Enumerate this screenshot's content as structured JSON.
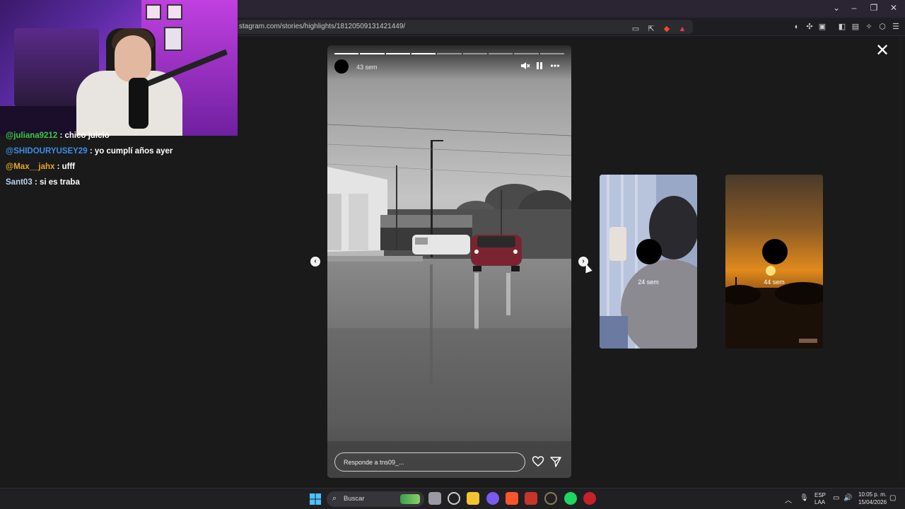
{
  "browser": {
    "url": "stagram.com/stories/highlights/18120509131421449/",
    "window_controls": [
      "⌄",
      "–",
      "❐",
      "✕"
    ]
  },
  "chat": {
    "messages": [
      {
        "user": "@juliana9212",
        "text": ": chico juicio",
        "color": "#39c84a"
      },
      {
        "user": "@SHIDOURYUSEY29",
        "text": ": yo cumplí años ayer",
        "color": "#3a8fe8"
      },
      {
        "user": "@Max__jahx",
        "text": ": ufff",
        "color": "#e8a826"
      },
      {
        "user": "Sant03",
        "text": ": si es traba",
        "color": "#b8d4f0"
      }
    ]
  },
  "story": {
    "time": "43 sem",
    "reply_placeholder": "Responde a tns09_...",
    "progress_segments": 9,
    "progress_done": 4,
    "icons": {
      "mute": "mute-icon",
      "pause": "pause-icon",
      "more": "more-icon",
      "like": "heart-icon",
      "share": "send-icon"
    }
  },
  "thumbnails": [
    {
      "time": "24 sem"
    },
    {
      "time": "44 sem"
    }
  ],
  "close_symbol": "✕",
  "taskbar": {
    "search_label": "Buscar",
    "lang_line1": "ESP",
    "lang_line2": "LAA",
    "clock_time": "10:05 p. m.",
    "clock_date": "15/04/2026"
  }
}
